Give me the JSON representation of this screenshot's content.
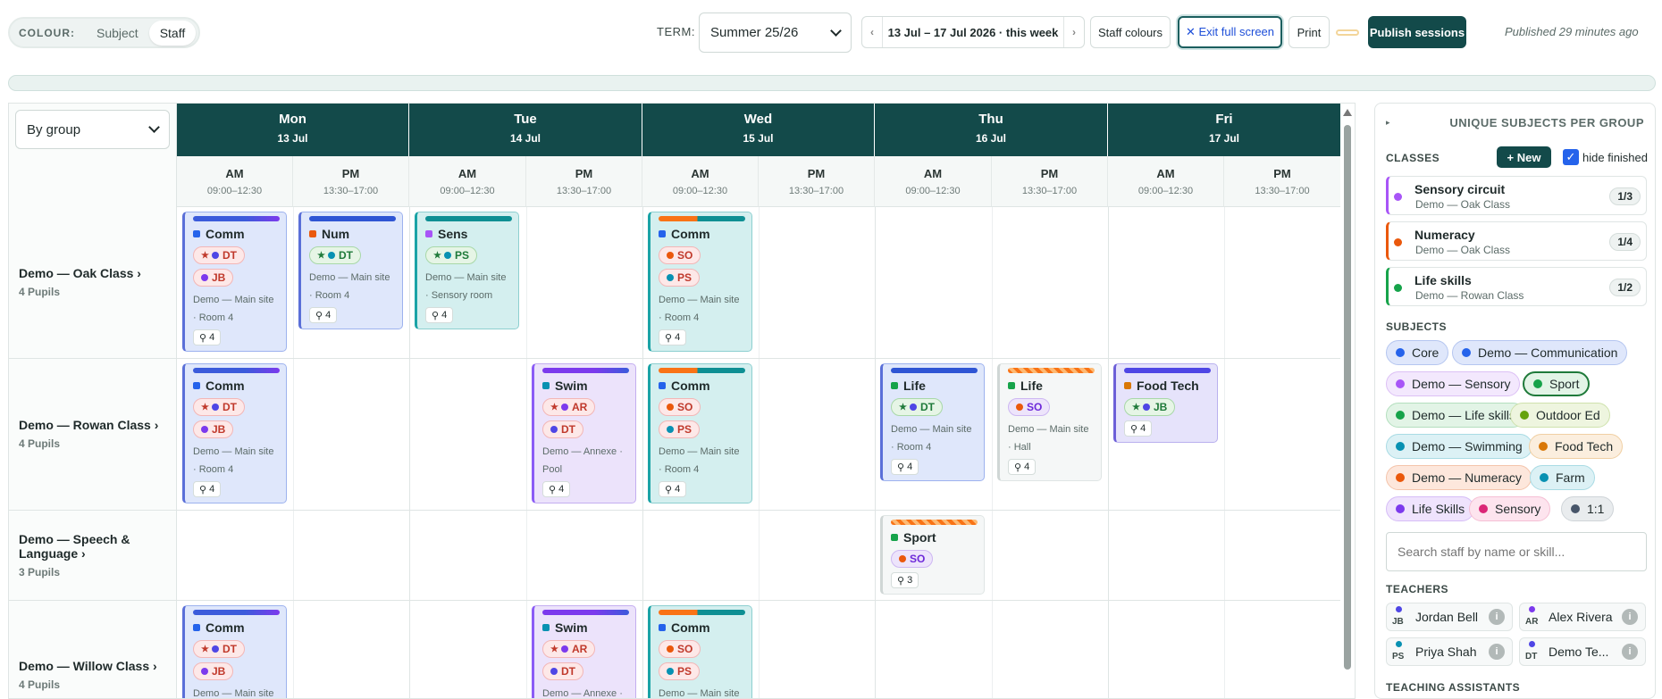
{
  "toolbar": {
    "colour_label": "COLOUR:",
    "colour_options": [
      "Subject",
      "Staff"
    ],
    "term_label": "TERM:",
    "term_value": "Summer 25/26",
    "week_label": "13 Jul – 17 Jul 2026 · this week",
    "prev": "‹",
    "next": "›",
    "staff_colours": "Staff colours",
    "exit_fullscreen": "✕ Exit full screen",
    "print": "Print",
    "publish": "Publish sessions",
    "published_status": "Published 29 minutes ago"
  },
  "grid": {
    "group_by": "By group",
    "days": [
      {
        "name": "Mon",
        "date": "13 Jul"
      },
      {
        "name": "Tue",
        "date": "14 Jul"
      },
      {
        "name": "Wed",
        "date": "15 Jul"
      },
      {
        "name": "Thu",
        "date": "16 Jul"
      },
      {
        "name": "Fri",
        "date": "17 Jul"
      }
    ],
    "slots": [
      {
        "label": "AM",
        "time": "09:00–12:30"
      },
      {
        "label": "PM",
        "time": "13:30–17:00"
      }
    ],
    "rows": [
      {
        "name": "Demo — Oak Class",
        "chev": "›",
        "pupils": "4 Pupils"
      },
      {
        "name": "Demo — Rowan Class",
        "chev": "›",
        "pupils": "4 Pupils"
      },
      {
        "name": "Demo — Speech & Language",
        "chev": "›",
        "pupils": "3 Pupils"
      },
      {
        "name": "Demo — Willow Class",
        "chev": "›",
        "pupils": "4 Pupils"
      }
    ],
    "cards": [
      {
        "title": "Comm",
        "staff": [
          "DT",
          "JB"
        ],
        "loc": "Demo — Main site · Room 4",
        "count": "4"
      },
      {
        "title": "Num",
        "staff": [
          "DT"
        ],
        "loc": "Demo — Main site · Room 4",
        "count": "4"
      },
      {
        "title": "Sens",
        "staff": [
          "PS"
        ],
        "loc": "Demo — Main site · Sensory room",
        "count": "4"
      },
      {
        "title": "Comm",
        "staff": [
          "SO",
          "PS"
        ],
        "loc": "Demo — Main site · Room 4",
        "count": "4"
      },
      {
        "title": "Comm",
        "staff": [
          "DT",
          "JB"
        ],
        "loc": "Demo — Main site · Room 4",
        "count": "4"
      },
      {
        "title": "Swim",
        "staff": [
          "AR",
          "DT"
        ],
        "loc": "Demo — Annexe · Pool",
        "count": "4"
      },
      {
        "title": "Comm",
        "staff": [
          "SO",
          "PS"
        ],
        "loc": "Demo — Main site · Room 4",
        "count": "4"
      },
      {
        "title": "Life",
        "staff": [
          "DT"
        ],
        "loc": "Demo — Main site · Room 4",
        "count": "4"
      },
      {
        "title": "Life",
        "staff": [
          "SO"
        ],
        "loc": "Demo — Main site · Hall",
        "count": "4"
      },
      {
        "title": "Food Tech",
        "staff": [
          "JB"
        ],
        "loc": "",
        "count": "4"
      },
      {
        "title": "Sport",
        "staff": [
          "SO"
        ],
        "loc": "",
        "count": "3"
      },
      {
        "title": "Comm",
        "staff": [
          "DT",
          "JB"
        ],
        "loc": "Demo — Main site ·",
        "count": ""
      },
      {
        "title": "Swim",
        "staff": [
          "AR",
          "DT"
        ],
        "loc": "Demo — Annexe ·",
        "count": ""
      },
      {
        "title": "Comm",
        "staff": [
          "SO",
          "PS"
        ],
        "loc": "Demo — Main site ·",
        "count": ""
      }
    ]
  },
  "sidebar": {
    "header": "UNIQUE SUBJECTS PER GROUP",
    "classes_label": "CLASSES",
    "new_button": "+ New",
    "hide_finished": "hide finished",
    "classes": [
      {
        "name": "Sensory circuit",
        "group": "Demo — Oak Class",
        "fraction": "1/3",
        "color": "#a855f7"
      },
      {
        "name": "Numeracy",
        "group": "Demo — Oak Class",
        "fraction": "1/4",
        "color": "#ea580c"
      },
      {
        "name": "Life skills",
        "group": "Demo — Rowan Class",
        "fraction": "1/2",
        "color": "#16a34a"
      }
    ],
    "subjects_label": "SUBJECTS",
    "subjects": [
      "Core",
      "Demo — Communication",
      "Demo — Sensory",
      "Sport",
      "Demo — Life skills",
      "Outdoor Ed",
      "Demo — Swimming",
      "Food Tech",
      "Demo — Numeracy",
      "Farm",
      "Life Skills",
      "Sensory",
      "1:1"
    ],
    "search_placeholder": "Search staff by name or skill...",
    "teachers_label": "TEACHERS",
    "teachers": [
      {
        "initials": "JB",
        "name": "Jordan Bell"
      },
      {
        "initials": "AR",
        "name": "Alex Rivera"
      },
      {
        "initials": "PS",
        "name": "Priya Shah"
      },
      {
        "initials": "DT",
        "name": "Demo Te..."
      }
    ],
    "tas_label": "TEACHING ASSISTANTS"
  }
}
